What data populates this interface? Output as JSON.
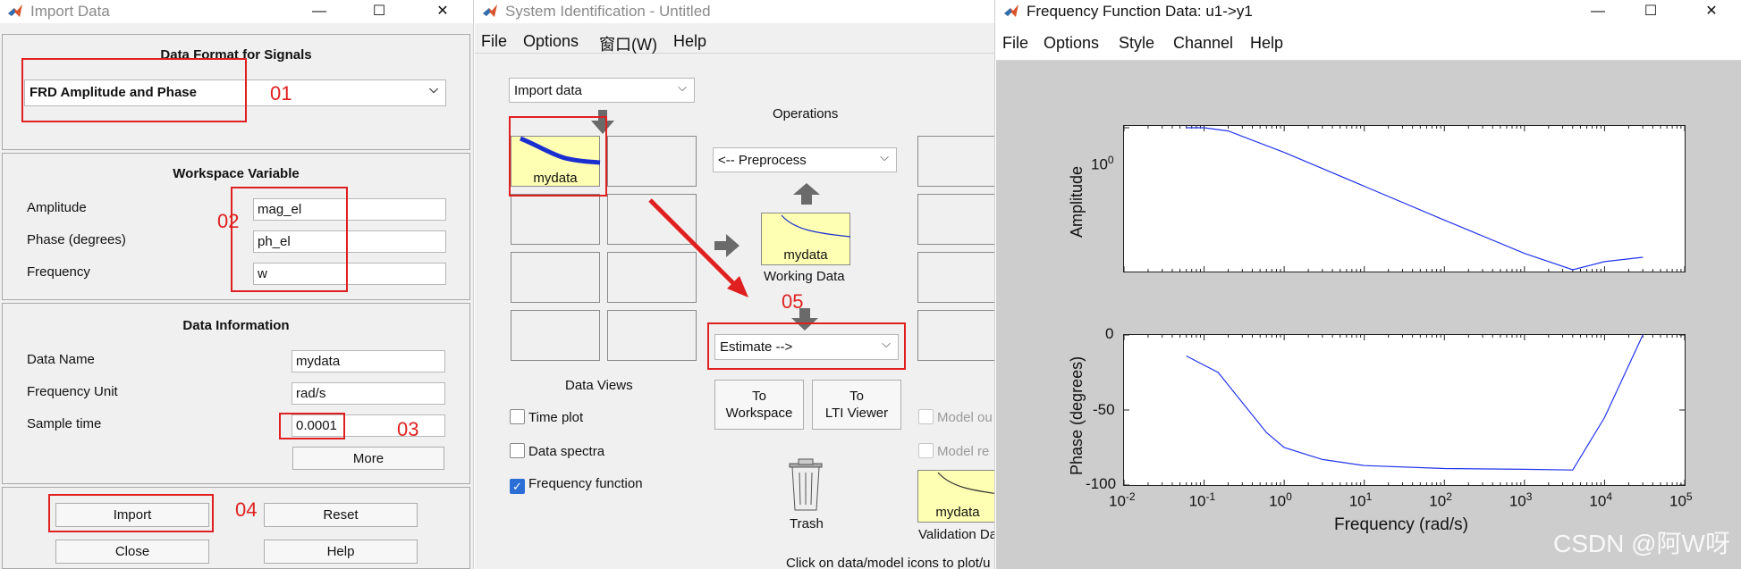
{
  "import_window": {
    "title": "Import Data",
    "format_panel": {
      "title": "Data Format for Signals",
      "format_value": "FRD Amplitude and Phase"
    },
    "workspace_panel": {
      "title": "Workspace Variable",
      "amplitude_label": "Amplitude",
      "amplitude_value": "mag_el",
      "phase_label": "Phase (degrees)",
      "phase_value": "ph_el",
      "frequency_label": "Frequency",
      "frequency_value": "w"
    },
    "info_panel": {
      "title": "Data Information",
      "data_name_label": "Data Name",
      "data_name_value": "mydata",
      "freq_unit_label": "Frequency Unit",
      "freq_unit_value": "rad/s",
      "sample_time_label": "Sample time",
      "sample_time_value": "0.0001",
      "more_label": "More"
    },
    "buttons": {
      "import": "Import",
      "reset": "Reset",
      "close": "Close",
      "help": "Help"
    },
    "annotations": [
      "01",
      "02",
      "03",
      "04"
    ]
  },
  "sysid_window": {
    "title": "System Identification - Untitled",
    "menu": [
      "File",
      "Options",
      "窗口(W)",
      "Help"
    ],
    "import_dropdown": "Import data",
    "operations_label": "Operations",
    "preprocess_dropdown": "<-- Preprocess",
    "data_icon_label": "mydata",
    "working_data_icon_label": "mydata",
    "working_data_label": "Working Data",
    "estimate_dropdown": "Estimate -->",
    "annotation": "05",
    "to_workspace_line1": "To",
    "to_workspace_line2": "Workspace",
    "to_lti_line1": "To",
    "to_lti_line2": "LTI Viewer",
    "data_views_label": "Data Views",
    "checkboxes": [
      {
        "label": "Time plot",
        "checked": false
      },
      {
        "label": "Data spectra",
        "checked": false
      },
      {
        "label": "Frequency function",
        "checked": true
      }
    ],
    "model_checkboxes": [
      {
        "label": "Model ou"
      },
      {
        "label": "Model re"
      }
    ],
    "trash_label": "Trash",
    "validation_icon_label": "mydata",
    "validation_label": "Validation Da",
    "footer_text": "Click on data/model icons to plot/u"
  },
  "freq_window": {
    "title": "Frequency Function Data: u1->y1",
    "menu": [
      "File",
      "Options",
      "Style",
      "Channel",
      "Help"
    ],
    "watermark": "CSDN @阿W呀",
    "chart_data": [
      {
        "type": "line",
        "ylabel": "Amplitude",
        "yscale": "log",
        "xscale": "log",
        "xlim": [
          0.01,
          100000
        ],
        "ytick_label": "10",
        "ytick_exp": "0",
        "series": [
          {
            "x": [
              0.06,
              0.1,
              0.2,
              1,
              10,
              100,
              1000,
              4000,
              10000,
              30000
            ],
            "y": [
              1.0,
              1.0,
              0.9,
              0.45,
              0.15,
              0.05,
              0.017,
              0.01,
              0.013,
              0.015
            ]
          }
        ]
      },
      {
        "type": "line",
        "ylabel": "Phase (degrees)",
        "xlabel": "Frequency (rad/s)",
        "xscale": "log",
        "xlim": [
          0.01,
          100000
        ],
        "ylim": [
          -100,
          0
        ],
        "yticks": [
          "0",
          "-50",
          "-100"
        ],
        "xtick_exponents": [
          "-2",
          "-1",
          "0",
          "1",
          "2",
          "3",
          "4",
          "5"
        ],
        "xtick_base": "10",
        "series": [
          {
            "x": [
              0.06,
              0.15,
              0.3,
              0.6,
              1,
              3,
              10,
              100,
              1000,
              4000,
              10000,
              30000
            ],
            "y": [
              -14,
              -25,
              -45,
              -65,
              -75,
              -83,
              -87,
              -89,
              -89.5,
              -90,
              -55,
              0
            ]
          }
        ]
      }
    ]
  }
}
